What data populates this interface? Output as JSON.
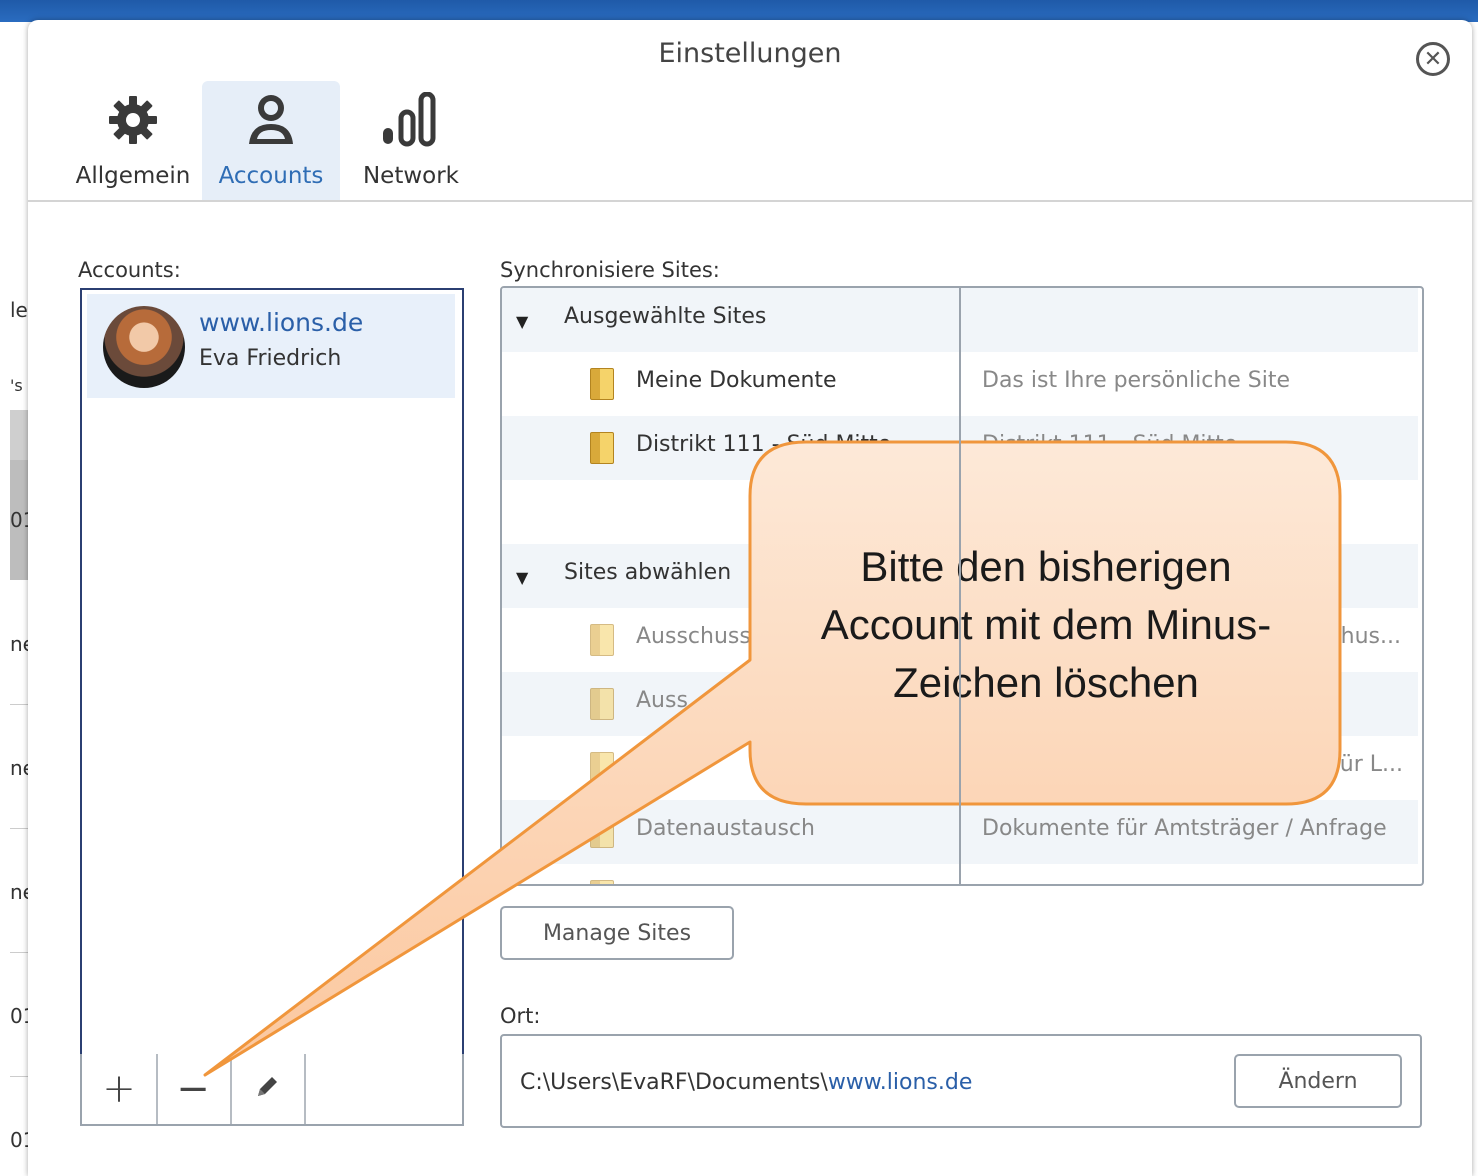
{
  "background": {
    "fragments": [
      "le",
      "'s",
      "01",
      "ne",
      "ne",
      "ne",
      "01",
      "01"
    ]
  },
  "dialog": {
    "title": "Einstellungen",
    "close_icon": "close-circle-icon"
  },
  "toolbar": {
    "tabs": [
      {
        "label": "Allgemein",
        "icon": "gear-icon",
        "active": false
      },
      {
        "label": "Accounts",
        "icon": "user-icon",
        "active": true
      },
      {
        "label": "Network",
        "icon": "signal-bars-icon",
        "active": false
      }
    ]
  },
  "accounts": {
    "heading": "Accounts:",
    "items": [
      {
        "site": "www.lions.de",
        "user": "Eva Friedrich",
        "selected": true
      }
    ],
    "buttons": {
      "add": "+",
      "remove": "−",
      "edit_icon": "pencil-icon"
    }
  },
  "sites": {
    "heading": "Synchronisiere Sites:",
    "groups": [
      {
        "name": "Ausgewählte Sites",
        "rows": [
          {
            "name": "Meine Dokumente",
            "desc": "Das ist Ihre persönliche Site"
          },
          {
            "name": "Distrikt 111 - Süd Mitte",
            "desc": "Distrikt 111 - Süd Mitte"
          }
        ]
      },
      {
        "name": "Sites abwählen",
        "rows": [
          {
            "name": "Ausschuss",
            "desc": "thus..."
          },
          {
            "name": "Auss",
            "desc": ""
          },
          {
            "name": "uss",
            "desc": "für L..."
          },
          {
            "name": "Datenaustausch",
            "desc": "Dokumente für Amtsträger / Anfrage"
          }
        ]
      }
    ],
    "manage_button": "Manage Sites"
  },
  "location": {
    "heading": "Ort:",
    "path_prefix": "C:\\Users\\EvaRF\\Documents\\",
    "path_highlight": "www.lions.de",
    "change_button": "Ändern"
  },
  "callout": {
    "lines": [
      "Bitte den bisherigen",
      "Account mit dem Minus-",
      "Zeichen löschen"
    ],
    "fill": "#fcd6b8",
    "stroke": "#f0963c"
  }
}
